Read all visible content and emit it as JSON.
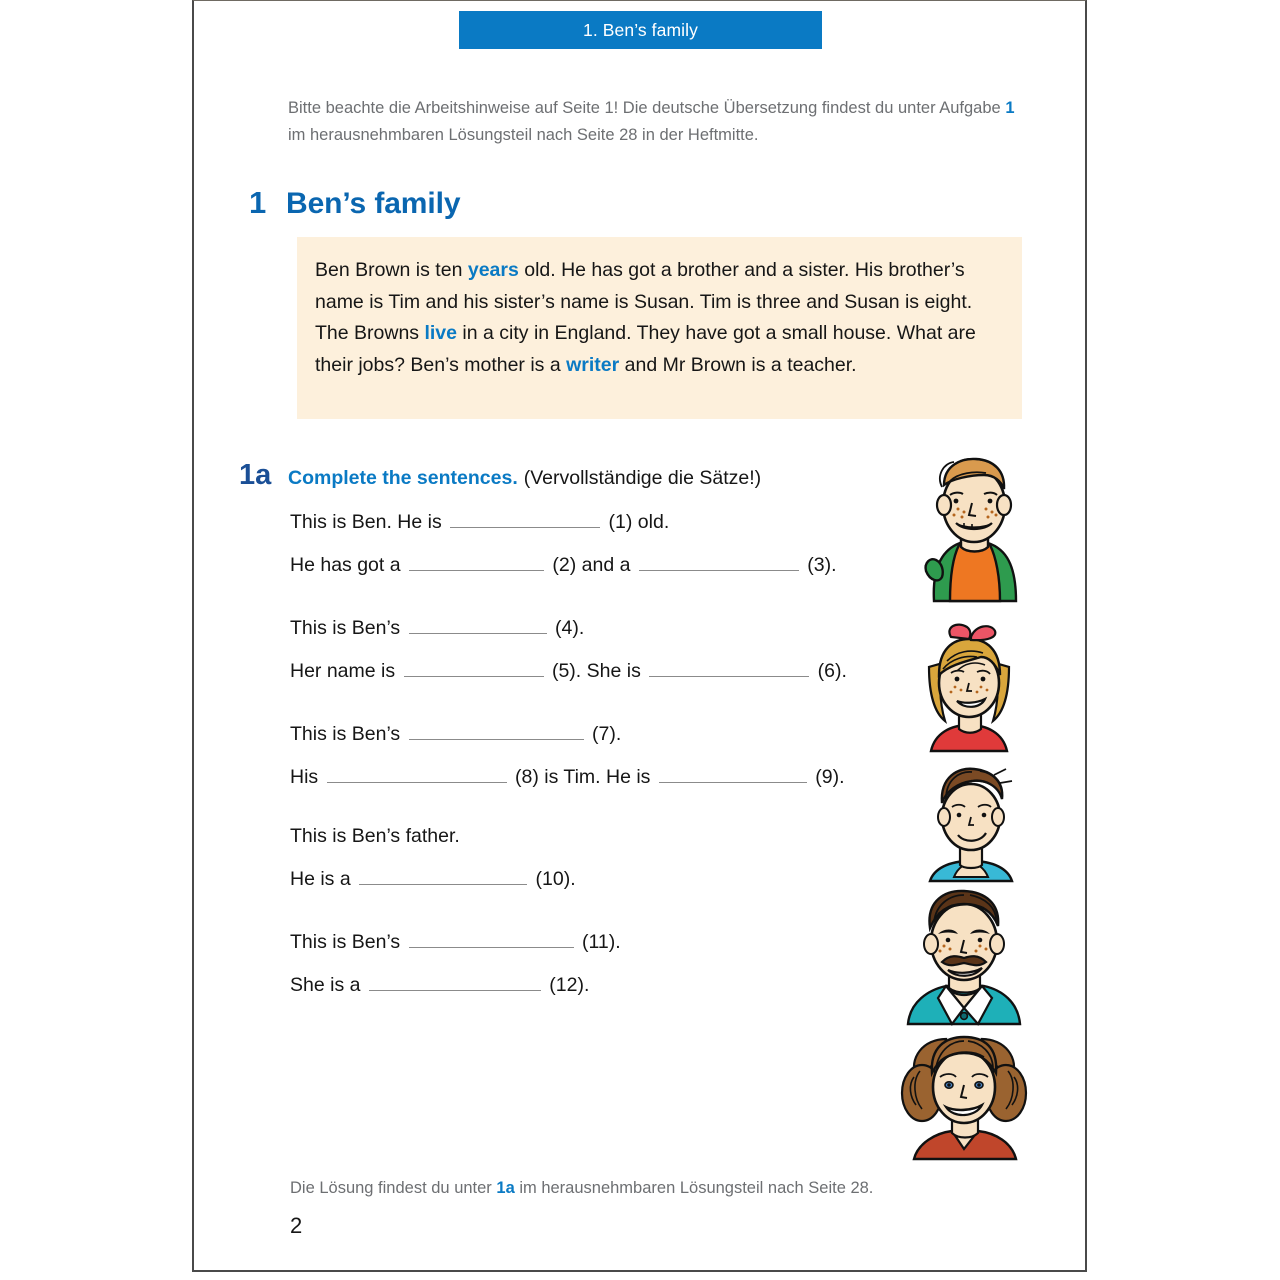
{
  "chapter_tab": {
    "label": "1. Ben’s family"
  },
  "intro_note": {
    "part1": "Bitte beachte die Arbeitshinweise auf Seite 1! Die deutsche Übersetzung findest du unter Aufgabe ",
    "highlight": "1",
    "part2": " im herausnehmbaren Lösungsteil nach Seite 28 in der Heftmitte."
  },
  "main_heading": {
    "number": "1",
    "title": "Ben’s family"
  },
  "story": {
    "s1": "Ben Brown is ten ",
    "b1": "years",
    "s2": " old. He has got a brother and a sister. His brother’s name is Tim and his sister’s name is Susan. Tim is three and Susan is eight. The Browns ",
    "b2": "live",
    "s3": " in a city in England. They have got a small house. What are their jobs? Ben’s mother is a ",
    "b3": "writer",
    "s4": " and Mr Brown is a teacher."
  },
  "task": {
    "number": "1a",
    "english": "Complete the sentences.",
    "german": "(Vervollständige die Sätze!)"
  },
  "exercises": [
    {
      "lines": [
        {
          "segments": [
            "This is Ben. He is ",
            "BLANK:150",
            " (1) old."
          ]
        },
        {
          "segments": [
            "He has got a ",
            "BLANK:135",
            " (2) and a ",
            "BLANK:160",
            " (3)."
          ]
        }
      ]
    },
    {
      "lines": [
        {
          "segments": [
            "This is Ben’s ",
            "BLANK:138",
            " (4)."
          ]
        },
        {
          "segments": [
            "Her name is ",
            "BLANK:140",
            " (5). She is ",
            "BLANK:160",
            " (6)."
          ]
        }
      ]
    },
    {
      "lines": [
        {
          "segments": [
            "This is Ben’s ",
            "BLANK:175",
            " (7)."
          ]
        },
        {
          "segments": [
            "His ",
            "BLANK:180",
            " (8) is Tim. He is ",
            "BLANK:148",
            " (9)."
          ]
        }
      ]
    },
    {
      "lines": [
        {
          "segments": [
            "This is Ben’s father."
          ]
        },
        {
          "segments": [
            "He is a ",
            "BLANK:168",
            " (10)."
          ]
        }
      ]
    },
    {
      "lines": [
        {
          "segments": [
            "This is Ben’s ",
            "BLANK:165",
            " (11)."
          ]
        },
        {
          "segments": [
            "She is a ",
            "BLANK:172",
            " (12)."
          ]
        }
      ]
    }
  ],
  "footer": {
    "part1": "Die Lösung findest du unter ",
    "highlight": "1a",
    "part2": " im herausnehmbaren Lösungsteil nach Seite 28.",
    "page_number": "2"
  },
  "illustrations": [
    {
      "name": "portrait-ben",
      "caption": "boy with curly light brown hair, freckles, green jacket over orange shirt"
    },
    {
      "name": "portrait-susan",
      "caption": "girl with blonde hair, red hair bow, freckles, red collar"
    },
    {
      "name": "portrait-tim",
      "caption": "young boy with brown spiky hair, blue shirt"
    },
    {
      "name": "portrait-father",
      "caption": "man with dark brown hair and moustache, teal shirt"
    },
    {
      "name": "portrait-mother",
      "caption": "woman with curly brown hair, blue eyes, red top"
    }
  ],
  "colors": {
    "brand_blue": "#0a7ac4",
    "heading_blue": "#0a66b0",
    "task_blue": "#1a4f96",
    "cream_box": "#fdf0dc",
    "grey_text": "#6d6f72"
  }
}
